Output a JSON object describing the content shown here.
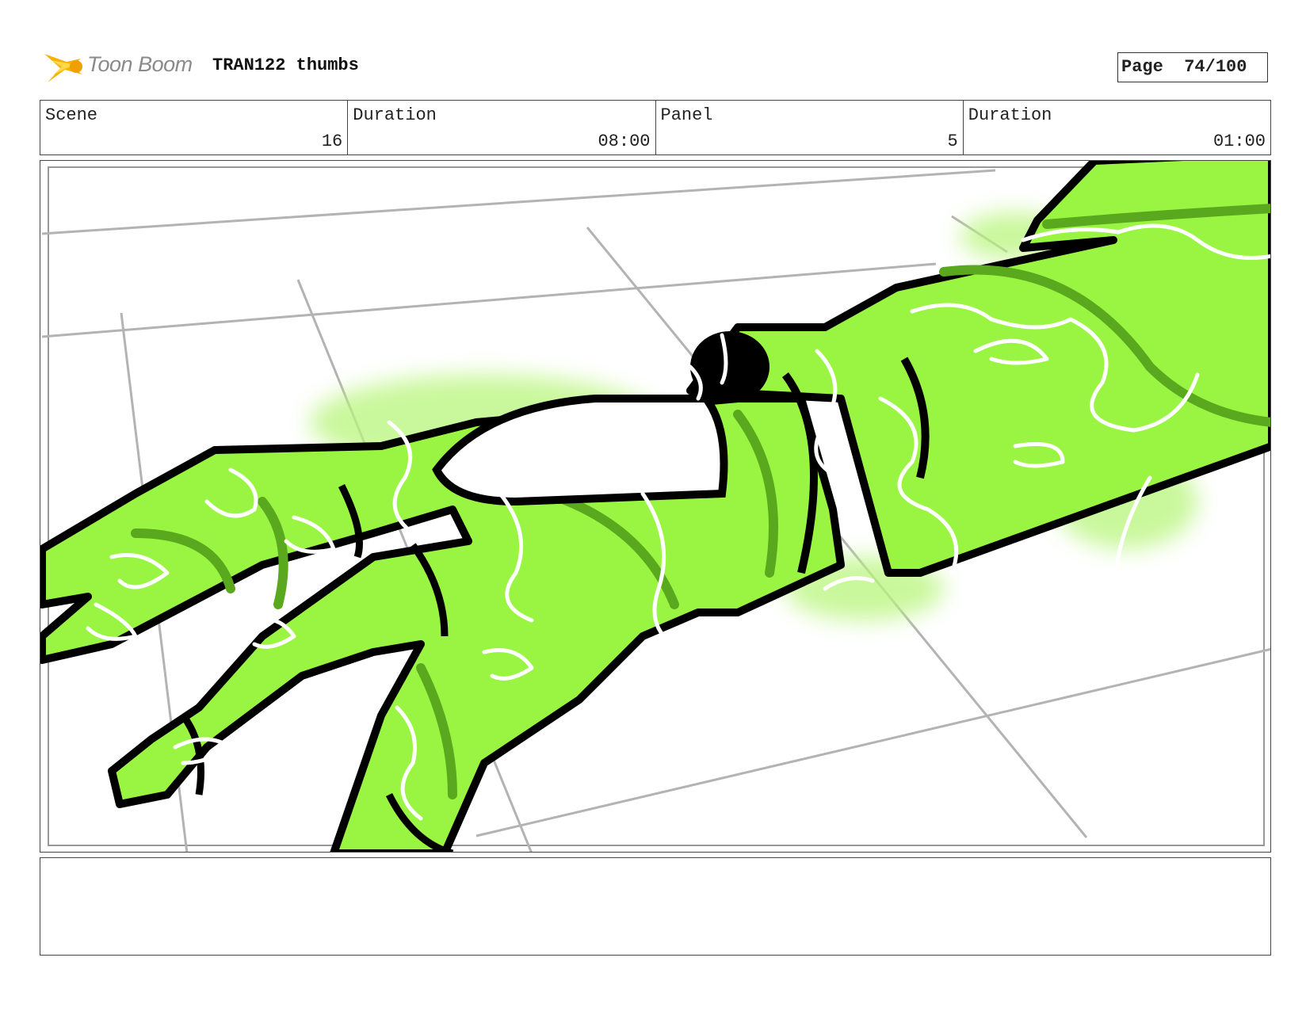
{
  "header": {
    "logo_text": "Toon Boom",
    "title": "TRAN122 thumbs",
    "page_label": "Page",
    "page_value": "74/100"
  },
  "info": {
    "scene_label": "Scene",
    "scene_value": "16",
    "scene_duration_label": "Duration",
    "scene_duration_value": "08:00",
    "panel_label": "Panel",
    "panel_value": "5",
    "panel_duration_label": "Duration",
    "panel_duration_value": "01:00"
  },
  "colors": {
    "alien_green": "#99f542",
    "shade_green": "#5aa81e",
    "ink": "#000000",
    "grid_grey": "#b3b3b3",
    "logo_orange": "#f5a800"
  },
  "notes": {
    "text": ""
  }
}
